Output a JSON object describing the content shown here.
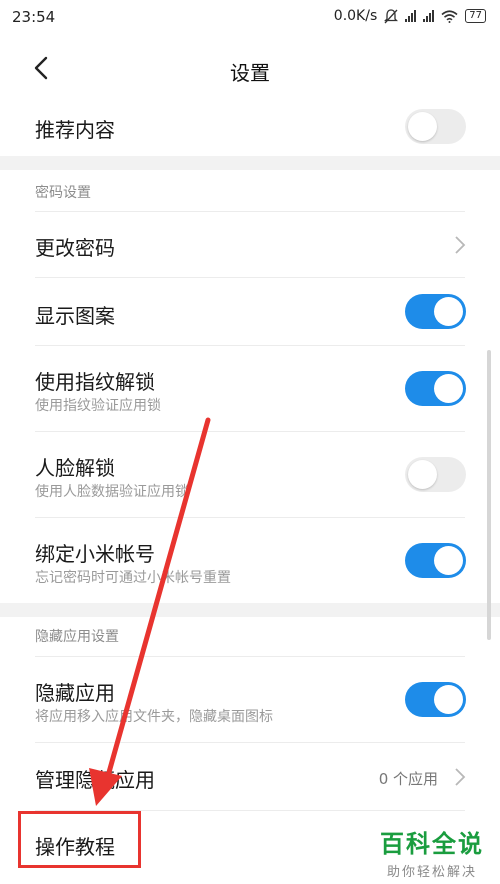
{
  "status_bar": {
    "time": "23:54",
    "network_speed": "0.0K/s",
    "battery": "77"
  },
  "header": {
    "title": "设置"
  },
  "top_row": {
    "label": "推荐内容",
    "toggle_on": false
  },
  "password_section": {
    "title": "密码设置",
    "change_password": "更改密码",
    "show_pattern": {
      "label": "显示图案",
      "on": true
    },
    "fingerprint": {
      "label": "使用指纹解锁",
      "sub": "使用指纹验证应用锁",
      "on": true
    },
    "face": {
      "label": "人脸解锁",
      "sub": "使用人脸数据验证应用锁",
      "on": false
    },
    "mi_account": {
      "label": "绑定小米帐号",
      "sub": "忘记密码时可通过小米帐号重置",
      "on": true
    }
  },
  "hidden_section": {
    "title": "隐藏应用设置",
    "hide_apps": {
      "label": "隐藏应用",
      "sub": "将应用移入应用文件夹，隐藏桌面图标",
      "on": true
    },
    "manage_hidden": {
      "label": "管理隐藏应用",
      "value": "0 个应用"
    },
    "tutorial": "操作教程"
  },
  "watermark": {
    "main": "百科全说",
    "sub": "助你轻松解决"
  },
  "colors": {
    "toggle_on": "#1e8ce9",
    "highlight": "#e8342f",
    "watermark": "#1a9d3f"
  }
}
